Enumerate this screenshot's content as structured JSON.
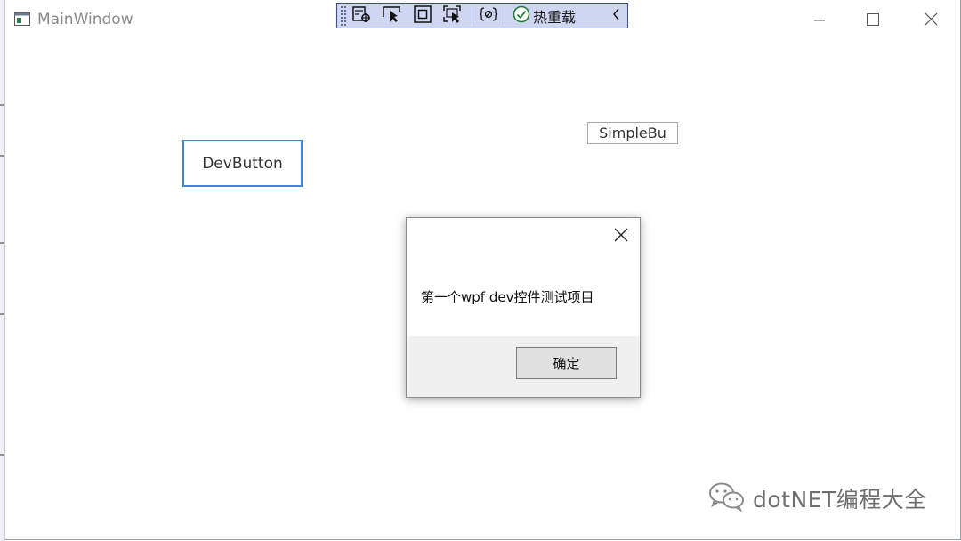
{
  "window": {
    "title": "MainWindow",
    "icon": "wpf-window-icon",
    "controls": {
      "minimize": "minimize-icon",
      "maximize": "maximize-icon",
      "close": "close-icon"
    }
  },
  "debug_toolbar": {
    "buttons": [
      "live-visual-tree-icon",
      "select-element-icon",
      "display-layout-adorners-icon",
      "track-focused-element-icon",
      "binding-failures-icon"
    ],
    "hot_reload_label": "热重载",
    "hot_reload_status": "check-circle-icon",
    "collapse": "chevron-left-icon",
    "border_color": "#3b4aa0",
    "background": "#cfd6f2"
  },
  "content": {
    "dev_button_label": "DevButton",
    "simple_button_label": "SimpleBu",
    "dev_button_border": "#3b86d8"
  },
  "message_box": {
    "text": "第一个wpf dev控件测试项目",
    "ok_label": "确定",
    "close": "close-icon"
  },
  "watermark": {
    "icon": "wechat-icon",
    "text": "dotNET编程大全"
  }
}
